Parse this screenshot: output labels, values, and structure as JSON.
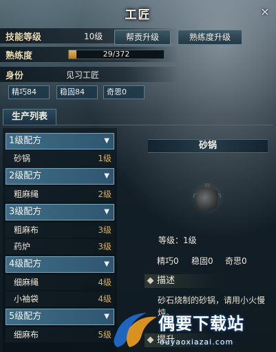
{
  "window": {
    "title": "工匠",
    "close_glyph": "✕"
  },
  "skill": {
    "level_label": "技能等级",
    "level_value": "10级",
    "btn_promote": "帮贡升级",
    "btn_proficiency": "熟练度升级",
    "proficiency_label": "熟练度",
    "proficiency_text": "29/372",
    "proficiency_fraction": 0.078,
    "role_label": "身份",
    "role_value": "见习工匠",
    "attrs": [
      "精巧84",
      "稳固84",
      "奇思0"
    ]
  },
  "list": {
    "tab_label": "生产列表",
    "groups": [
      {
        "label": "1级配方",
        "items": [
          {
            "name": "砂锅",
            "level": "1级"
          }
        ]
      },
      {
        "label": "2级配方",
        "items": [
          {
            "name": "粗麻绳",
            "level": "2级"
          }
        ]
      },
      {
        "label": "3级配方",
        "items": [
          {
            "name": "粗麻布",
            "level": "3级"
          },
          {
            "name": "药炉",
            "level": "3级"
          }
        ]
      },
      {
        "label": "4级配方",
        "items": [
          {
            "name": "细麻绳",
            "level": "4级"
          },
          {
            "name": "小袖袋",
            "level": "4级"
          }
        ]
      },
      {
        "label": "5级配方",
        "items": [
          {
            "name": "细麻布",
            "level": "5级"
          }
        ]
      }
    ],
    "arrow_glyph": "▼"
  },
  "detail": {
    "item_name": "砂锅",
    "level_text": "等级：1级",
    "stats": [
      "精巧0",
      "稳固0",
      "奇思0"
    ],
    "section_desc": "描述",
    "description": "砂石烧制的砂锅，请用小火慢炖。",
    "section_extra": "提升"
  },
  "watermark": {
    "text": "偶要下载站",
    "url": "ouyaoxiazai.com"
  },
  "colors": {
    "group_bg": "#3f6c86",
    "level_gold": "#d8b25a",
    "exp_fill": "#e3b65a"
  }
}
